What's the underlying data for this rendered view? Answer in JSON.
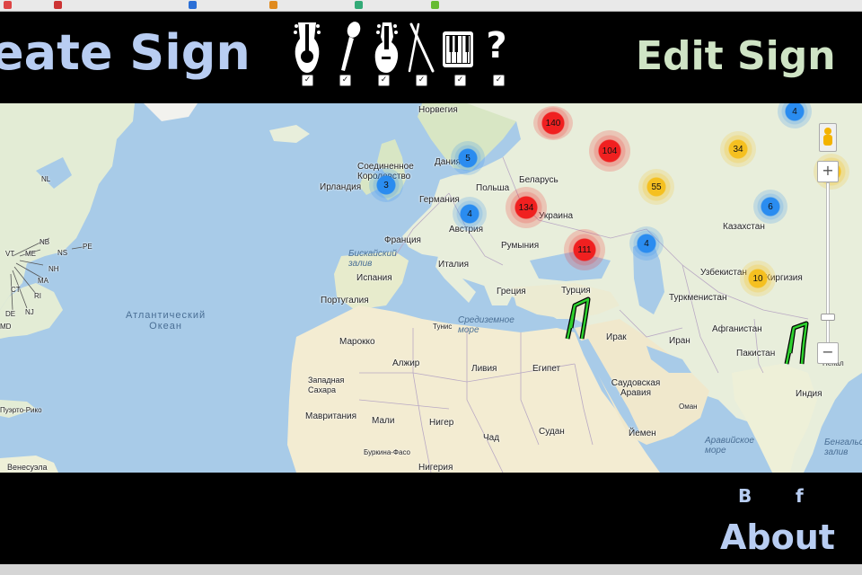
{
  "header": {
    "create_title": "eate Sign",
    "edit_title": "Edit Sign",
    "instruments": [
      {
        "icon": "guitar-icon"
      },
      {
        "icon": "microphone-icon"
      },
      {
        "icon": "bass-guitar-icon"
      },
      {
        "icon": "drumsticks-icon"
      },
      {
        "icon": "piano-icon"
      },
      {
        "icon": "question-mark-icon",
        "label": "?"
      }
    ],
    "checkbox_mark": "✓"
  },
  "map": {
    "labels": {
      "norway": "Норвегия",
      "uk": "Соединенное Королевство",
      "ireland": "Ирландия",
      "denmark": "Дания",
      "germany": "Германия",
      "poland": "Польша",
      "belarus": "Беларусь",
      "ukraine": "Украина",
      "austria": "Австрия",
      "france": "Франция",
      "romania": "Румыния",
      "italy": "Италия",
      "spain": "Испания",
      "portugal": "Португалия",
      "greece": "Греция",
      "turkey": "Турция",
      "tunisia": "Тунис",
      "morocco": "Марокко",
      "algeria": "Алжир",
      "libya": "Ливия",
      "egypt": "Египет",
      "iraq": "Ирак",
      "iran": "Иран",
      "saudi": "Саудовская Аравия",
      "oman": "Оман",
      "yemen": "Йемен",
      "afghanistan": "Афганистан",
      "pakistan": "Пакистан",
      "india": "Индия",
      "nepal": "Непал",
      "kazakhstan": "Казахстан",
      "uzbekistan": "Узбекистан",
      "kyrgyzstan": "Киргизия",
      "turkmenistan": "Туркменистан",
      "western_sahara": "Западная Сахара",
      "mauritania": "Мавритания",
      "mali": "Мали",
      "niger": "Нигер",
      "chad": "Чад",
      "sudan": "Судан",
      "burkina": "Буркина-Фасо",
      "nigeria": "Нигерия",
      "puerto_rico": "Пуэрто-Рико",
      "venezuela": "Венесуэла",
      "bengal": "Бенгальский залив",
      "arabian_sea": "Аравийское море",
      "biscay": "Бискайский залив",
      "med": "Средиземное море",
      "atlantic_1": "Атлантический",
      "atlantic_2": "Океан",
      "nl": "NL",
      "pe": "PE",
      "ns": "NS",
      "nb": "NB",
      "me": "ME",
      "vt": "VT",
      "nh": "NH",
      "ma": "MA",
      "ri": "RI",
      "ct": "CT",
      "nj": "NJ",
      "de": "DE",
      "md": "MD"
    },
    "clusters": {
      "c140": "140",
      "c104": "104",
      "c134": "134",
      "c111": "111",
      "c5": "5",
      "c3": "3",
      "c4a": "4",
      "c4b": "4",
      "c4c": "4",
      "c55": "55",
      "c34": "34",
      "c6": "6",
      "c10": "10"
    },
    "colors": {
      "red": "#f02020",
      "blue": "#2a8cf0",
      "yellow": "#f5c020",
      "sea": "#a8cbe8",
      "land": "#eef0d8",
      "desert": "#f3ecd2"
    },
    "zoom_in": "+",
    "zoom_out": "−"
  },
  "footer": {
    "social_b": "B",
    "social_f": "f",
    "about": "About"
  }
}
